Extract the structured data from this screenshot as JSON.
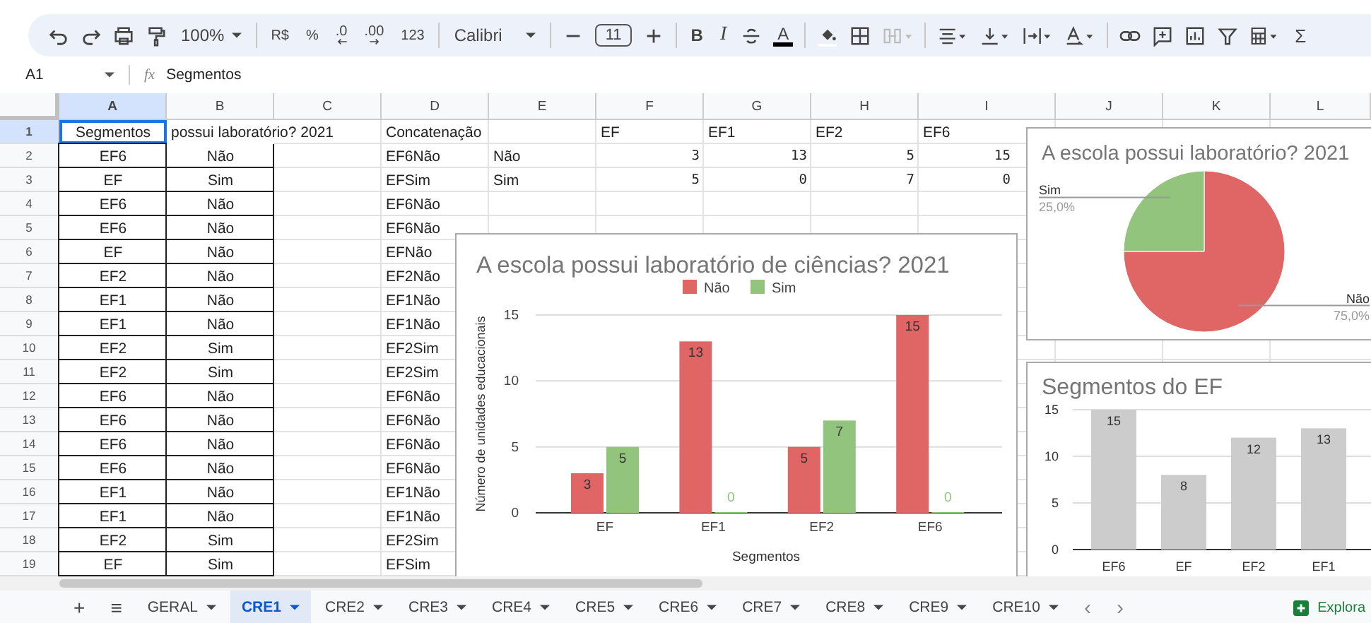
{
  "toolbar": {
    "zoom": "100%",
    "currency": "R$",
    "percent": "%",
    "decrease_decimals": ".0",
    "increase_decimals": ".00",
    "number_format": "123",
    "font": "Calibri",
    "font_size": "11",
    "bold": "B",
    "italic": "I",
    "text_color": "A",
    "sum": "Σ"
  },
  "formula_bar": {
    "cell": "A1",
    "fx": "fx",
    "value": "Segmentos"
  },
  "columns": [
    {
      "label": "A",
      "selected": true
    },
    {
      "label": "B",
      "selected": false
    },
    {
      "label": "C",
      "selected": false
    },
    {
      "label": "D",
      "selected": false
    },
    {
      "label": "E",
      "selected": false
    },
    {
      "label": "F",
      "selected": false
    },
    {
      "label": "G",
      "selected": false
    },
    {
      "label": "H",
      "selected": false
    },
    {
      "label": "I",
      "selected": false
    },
    {
      "label": "J",
      "selected": false
    },
    {
      "label": "K",
      "selected": false
    },
    {
      "label": "L",
      "selected": false
    }
  ],
  "rows": [
    {
      "number": "1",
      "selected": true,
      "cells": [
        "Segmentos",
        "possui laboratório? 2021",
        null,
        "Concatenação",
        null,
        "EF",
        "EF1",
        "EF2",
        "EF6"
      ]
    },
    {
      "number": "2",
      "selected": false,
      "cells": [
        "EF6",
        "Não",
        null,
        "EF6Não",
        "Não",
        "3",
        "13",
        "5",
        "15"
      ]
    },
    {
      "number": "3",
      "selected": false,
      "cells": [
        "EF",
        "Sim",
        null,
        "EFSim",
        "Sim",
        "5",
        "0",
        "7",
        "0"
      ]
    },
    {
      "number": "4",
      "selected": false,
      "cells": [
        "EF6",
        "Não",
        null,
        "EF6Não"
      ]
    },
    {
      "number": "5",
      "selected": false,
      "cells": [
        "EF6",
        "Não",
        null,
        "EF6Não"
      ]
    },
    {
      "number": "6",
      "selected": false,
      "cells": [
        "EF",
        "Não",
        null,
        "EFNão"
      ]
    },
    {
      "number": "7",
      "selected": false,
      "cells": [
        "EF2",
        "Não",
        null,
        "EF2Não"
      ]
    },
    {
      "number": "8",
      "selected": false,
      "cells": [
        "EF1",
        "Não",
        null,
        "EF1Não"
      ]
    },
    {
      "number": "9",
      "selected": false,
      "cells": [
        "EF1",
        "Não",
        null,
        "EF1Não"
      ]
    },
    {
      "number": "10",
      "selected": false,
      "cells": [
        "EF2",
        "Sim",
        null,
        "EF2Sim"
      ]
    },
    {
      "number": "11",
      "selected": false,
      "cells": [
        "EF2",
        "Sim",
        null,
        "EF2Sim"
      ]
    },
    {
      "number": "12",
      "selected": false,
      "cells": [
        "EF6",
        "Não",
        null,
        "EF6Não"
      ]
    },
    {
      "number": "13",
      "selected": false,
      "cells": [
        "EF6",
        "Não",
        null,
        "EF6Não"
      ]
    },
    {
      "number": "14",
      "selected": false,
      "cells": [
        "EF6",
        "Não",
        null,
        "EF6Não"
      ]
    },
    {
      "number": "15",
      "selected": false,
      "cells": [
        "EF6",
        "Não",
        null,
        "EF6Não"
      ]
    },
    {
      "number": "16",
      "selected": false,
      "cells": [
        "EF1",
        "Não",
        null,
        "EF1Não"
      ]
    },
    {
      "number": "17",
      "selected": false,
      "cells": [
        "EF1",
        "Não",
        null,
        "EF1Não"
      ]
    },
    {
      "number": "18",
      "selected": false,
      "cells": [
        "EF2",
        "Sim",
        null,
        "EF2Sim"
      ]
    },
    {
      "number": "19",
      "selected": false,
      "cells": [
        "EF",
        "Sim",
        null,
        "EFSim"
      ]
    }
  ],
  "charts": [
    {
      "chart_data": {
        "type": "bar",
        "title": "A escola possui laboratório de ciências? 2021",
        "xlabel": "Segmentos",
        "ylabel": "Número de unidades educacionais",
        "categories": [
          "EF",
          "EF1",
          "EF2",
          "EF6"
        ],
        "series": [
          {
            "name": "Não",
            "color": "#e06666",
            "values": [
              3,
              13,
              5,
              15
            ]
          },
          {
            "name": "Sim",
            "color": "#93c47d",
            "values": [
              5,
              0,
              7,
              0
            ]
          }
        ],
        "legend": "top",
        "ylim": [
          0,
          15
        ],
        "yticks": [
          0,
          5,
          10,
          15
        ],
        "data_labels": true
      }
    },
    {
      "chart_data": {
        "type": "pie",
        "title": "A escola possui laboratório? 2021",
        "categories": [
          "Não",
          "Sim"
        ],
        "values": [
          75,
          25
        ],
        "colors": [
          "#e06666",
          "#93c47d"
        ],
        "value_labels": [
          "75,0%",
          "25,0%"
        ]
      }
    },
    {
      "chart_data": {
        "type": "bar",
        "title": "Segmentos do EF",
        "categories": [
          "EF6",
          "EF",
          "EF2",
          "EF1"
        ],
        "values": [
          15,
          8,
          12,
          13
        ],
        "ylim": [
          0,
          15
        ],
        "yticks": [
          0,
          5,
          10,
          15
        ],
        "data_labels": true
      }
    }
  ],
  "sheet_controls": {
    "add": "+",
    "all_sheets": "≡"
  },
  "sheets": [
    {
      "label": "GERAL",
      "selected": false
    },
    {
      "label": "CRE1",
      "selected": true
    },
    {
      "label": "CRE2",
      "selected": false
    },
    {
      "label": "CRE3",
      "selected": false
    },
    {
      "label": "CRE4",
      "selected": false
    },
    {
      "label": "CRE5",
      "selected": false
    },
    {
      "label": "CRE6",
      "selected": false
    },
    {
      "label": "CRE7",
      "selected": false
    },
    {
      "label": "CRE8",
      "selected": false
    },
    {
      "label": "CRE9",
      "selected": false
    },
    {
      "label": "CRE10",
      "selected": false
    }
  ],
  "sheet_nav": {
    "previous": "‹",
    "next": "›"
  },
  "explore": {
    "label": "Explora"
  }
}
